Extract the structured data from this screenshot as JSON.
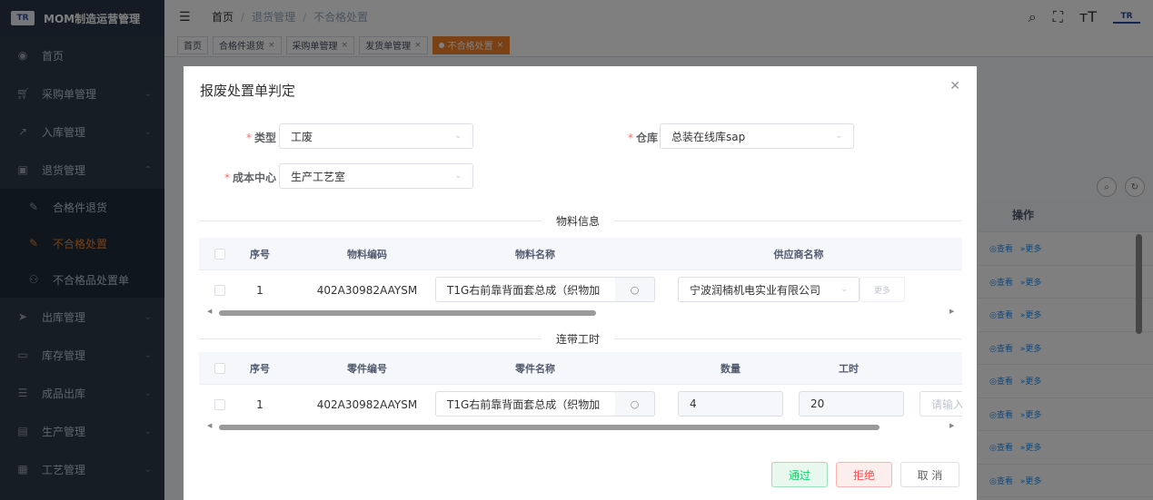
{
  "app": {
    "logo_text": "TR",
    "title": "MOM制造运营管理"
  },
  "sidebar": {
    "items": [
      {
        "label": "首页",
        "icon": "dashboard-icon"
      },
      {
        "label": "采购单管理",
        "icon": "cart-icon"
      },
      {
        "label": "入库管理",
        "icon": "inbound-icon"
      },
      {
        "label": "退货管理",
        "icon": "return-icon"
      },
      {
        "label": "出库管理",
        "icon": "outbound-icon"
      },
      {
        "label": "库存管理",
        "icon": "inventory-icon"
      },
      {
        "label": "成品出库",
        "icon": "list-icon"
      },
      {
        "label": "生产管理",
        "icon": "production-icon"
      },
      {
        "label": "工艺管理",
        "icon": "process-icon"
      }
    ],
    "submenu": [
      {
        "label": "合格件退货",
        "icon": "edit-icon"
      },
      {
        "label": "不合格处置",
        "icon": "edit-icon"
      },
      {
        "label": "不合格品处置单",
        "icon": "people-icon"
      }
    ]
  },
  "header": {
    "breadcrumb": [
      "首页",
      "退货管理",
      "不合格处置"
    ],
    "sep": "/"
  },
  "tags": [
    {
      "label": "首页"
    },
    {
      "label": "合格件退货"
    },
    {
      "label": "采购单管理"
    },
    {
      "label": "发货单管理"
    },
    {
      "label": "不合格处置"
    }
  ],
  "background": {
    "op_header": "操作",
    "view_label": "查看",
    "more_label": "更多"
  },
  "modal": {
    "title": "报废处置单判定",
    "form": {
      "type_label": "类型",
      "type_value": "工废",
      "warehouse_label": "仓库",
      "warehouse_value": "总装在线库sap",
      "cost_center_label": "成本中心",
      "cost_center_value": "生产工艺室"
    },
    "material_section": {
      "title": "物料信息",
      "columns": [
        "序号",
        "物料编码",
        "物料名称",
        "供应商名称"
      ],
      "rows": [
        {
          "index": "1",
          "code": "402A30982AAYSM",
          "name": "T1G右前靠背面套总成（织物加",
          "supplier": "宁波润楠机电实业有限公司",
          "more": "更多"
        }
      ]
    },
    "labor_section": {
      "title": "连带工时",
      "columns": [
        "序号",
        "零件编号",
        "零件名称",
        "数量",
        "工时"
      ],
      "rows": [
        {
          "index": "1",
          "code": "402A30982AAYSM",
          "name": "T1G右前靠背面套总成（织物加",
          "quantity": "4",
          "hours": "20",
          "placeholder": "请输入"
        }
      ]
    },
    "buttons": {
      "pass": "通过",
      "reject": "拒绝",
      "cancel": "取 消"
    }
  }
}
